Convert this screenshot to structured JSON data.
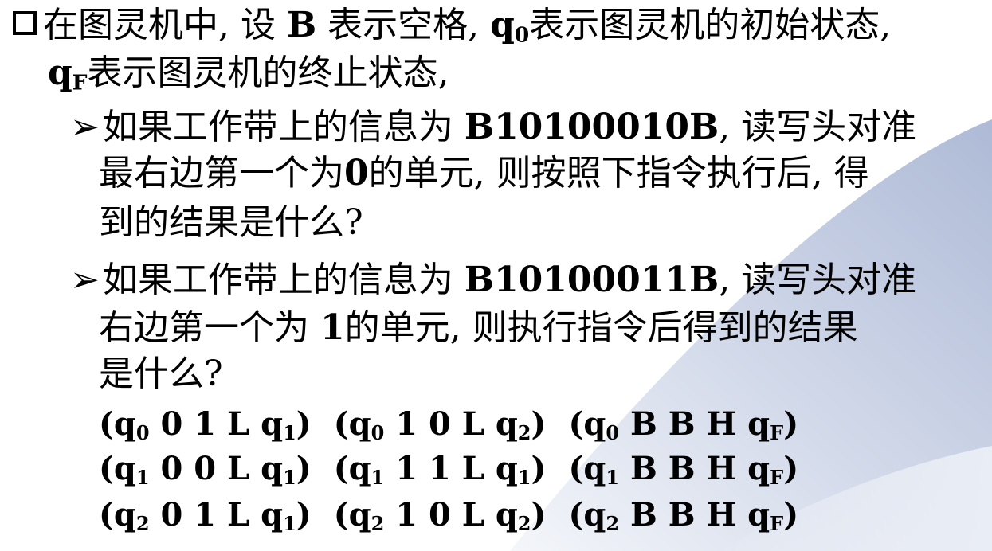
{
  "intro": {
    "line1_a": "在图灵机中, 设 ",
    "line1_b": "B",
    "line1_c": " 表示空格, ",
    "line1_q": "q",
    "line1_q_sub": "0",
    "line1_d": "表示图灵机的初始状态,",
    "line2_q": "q",
    "line2_q_sub": "F",
    "line2_d": "表示图灵机的终止状态,"
  },
  "question1": {
    "arrow": "➢",
    "l1_a": "如果工作带上的信息为 ",
    "l1_tape": "B10100010B",
    "l1_b": ", 读写头对准",
    "l2_a": "最右边第一个为",
    "l2_zero": "0",
    "l2_b": "的单元, 则按照下指令执行后, 得",
    "l3": "到的结果是什么?"
  },
  "question2": {
    "arrow": "➢",
    "l1_a": "如果工作带上的信息为 ",
    "l1_tape": "B10100011B",
    "l1_b": ", 读写头对准",
    "l2_a": "右边第一个为 ",
    "l2_one": "1",
    "l2_b": "的单元, 则执行指令后得到的结果",
    "l3": "是什么?"
  },
  "rules": [
    [
      {
        "s": "0",
        "body": " 0 1 L q",
        "to": "1"
      },
      {
        "s": "0",
        "body": " 1 0 L q",
        "to": "2"
      },
      {
        "s": "0",
        "body": " B B H q",
        "to": "F"
      }
    ],
    [
      {
        "s": "1",
        "body": " 0 0 L q",
        "to": "1"
      },
      {
        "s": "1",
        "body": " 1 1 L q",
        "to": "1"
      },
      {
        "s": "1",
        "body": "  B B H q",
        "to": "F"
      }
    ],
    [
      {
        "s": "2",
        "body": " 0 1 L q",
        "to": "1"
      },
      {
        "s": "2",
        "body": " 1 0 L q",
        "to": "2"
      },
      {
        "s": "2",
        "body": " B B H q",
        "to": "F"
      }
    ]
  ],
  "colors": {
    "swoosh_dark": "#b7c2dc",
    "swoosh_light": "#e6eaf3",
    "text": "#000000"
  }
}
